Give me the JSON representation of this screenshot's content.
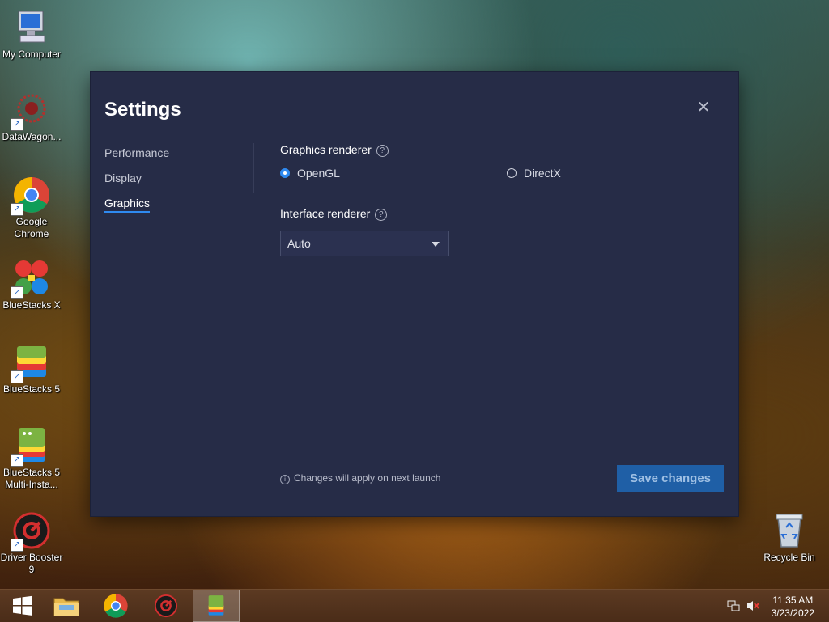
{
  "desktop": {
    "icons": [
      {
        "label": "My Computer"
      },
      {
        "label": "DataWagon..."
      },
      {
        "label": "Google Chrome"
      },
      {
        "label": "BlueStacks X"
      },
      {
        "label": "BlueStacks 5"
      },
      {
        "label": "BlueStacks 5 Multi-Insta..."
      },
      {
        "label": "Driver Booster 9"
      },
      {
        "label": "Recycle Bin"
      }
    ]
  },
  "settings": {
    "title": "Settings",
    "close_glyph": "✕",
    "nav": [
      {
        "label": "Performance"
      },
      {
        "label": "Display"
      },
      {
        "label": "Graphics",
        "active": true
      }
    ],
    "graphics_renderer": {
      "label": "Graphics renderer",
      "help_glyph": "?",
      "options": [
        {
          "label": "OpenGL",
          "selected": true
        },
        {
          "label": "DirectX",
          "selected": false
        }
      ]
    },
    "interface_renderer": {
      "label": "Interface renderer",
      "help_glyph": "?",
      "selected": "Auto"
    },
    "note": "Changes will apply on next launch",
    "note_glyph": "i",
    "save_label": "Save changes",
    "accent_color": "#2f8af0",
    "background_color": "#262c47"
  },
  "taskbar": {
    "time": "11:35 AM",
    "date": "3/23/2022",
    "pinned": [
      "windows-start",
      "file-explorer",
      "google-chrome",
      "driver-booster",
      "bluestacks-multi-instance"
    ],
    "active_app": "bluestacks-multi-instance"
  }
}
